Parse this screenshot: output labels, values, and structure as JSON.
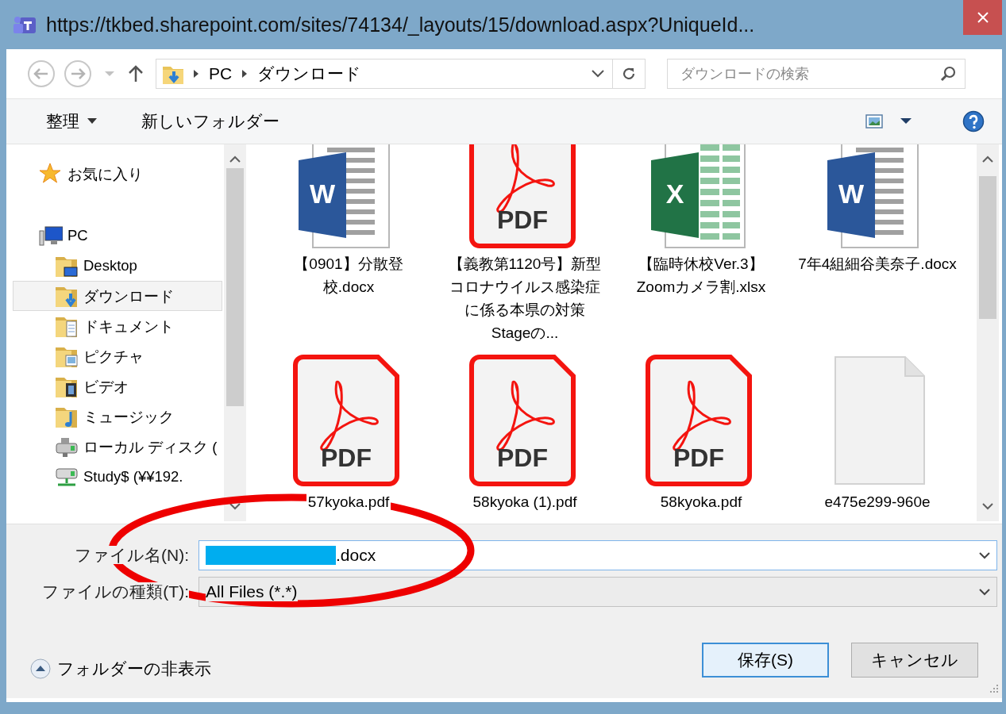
{
  "window": {
    "title": "https://tkbed.sharepoint.com/sites/74134/_layouts/15/download.aspx?UniqueId..."
  },
  "address_bar": {
    "path": [
      "PC",
      "ダウンロード"
    ]
  },
  "search": {
    "placeholder": "ダウンロードの検索"
  },
  "toolbar": {
    "organize": "整理",
    "new_folder": "新しいフォルダー"
  },
  "sidebar": {
    "items": [
      {
        "label": "お気に入り",
        "kind": "favorites",
        "selected": false
      },
      {
        "label": "PC",
        "kind": "pc",
        "selected": false,
        "children": [
          {
            "label": "Desktop",
            "kind": "desktop",
            "selected": false
          },
          {
            "label": "ダウンロード",
            "kind": "downloads",
            "selected": true
          },
          {
            "label": "ドキュメント",
            "kind": "documents",
            "selected": false
          },
          {
            "label": "ピクチャ",
            "kind": "pictures",
            "selected": false
          },
          {
            "label": "ビデオ",
            "kind": "videos",
            "selected": false
          },
          {
            "label": "ミュージック",
            "kind": "music",
            "selected": false
          },
          {
            "label": "ローカル ディスク (",
            "kind": "drive",
            "selected": false
          },
          {
            "label": "Study$ (¥¥192.",
            "kind": "network",
            "selected": false
          }
        ]
      }
    ]
  },
  "files": [
    {
      "name": "【0901】分散登校.docx",
      "kind": "word",
      "icon_text": "W"
    },
    {
      "name": "【義教第1120号】新型コロナウイルス感染症に係る本県の対策Stageの...",
      "kind": "pdf",
      "icon_text": "PDF"
    },
    {
      "name": "【臨時休校Ver.3】Zoomカメラ割.xlsx",
      "kind": "excel",
      "icon_text": "X"
    },
    {
      "name": "7年4組細谷美奈子.docx",
      "kind": "word",
      "icon_text": "W"
    },
    {
      "name": "57kyoka.pdf",
      "kind": "pdf",
      "icon_text": "PDF"
    },
    {
      "name": "58kyoka (1).pdf",
      "kind": "pdf",
      "icon_text": "PDF"
    },
    {
      "name": "58kyoka.pdf",
      "kind": "pdf",
      "icon_text": "PDF"
    },
    {
      "name": "e475e299-960e",
      "kind": "blank"
    }
  ],
  "file_name": {
    "label": "ファイル名(N):",
    "value": ".docx",
    "redacted": true
  },
  "file_type": {
    "label": "ファイルの種類(T):",
    "value": "All Files (*.*)"
  },
  "hide_folders": "フォルダーの非表示",
  "buttons": [
    {
      "label": "保存(S)",
      "kind": "primary"
    },
    {
      "label": "キャンセル",
      "kind": "normal"
    }
  ],
  "annotation": {
    "kind": "ellipse"
  }
}
